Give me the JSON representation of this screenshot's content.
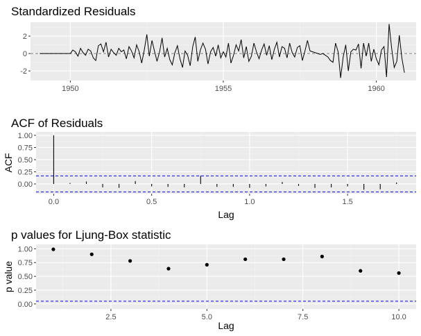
{
  "chart_data": [
    {
      "type": "line",
      "title": "Standardized Residuals",
      "xlabel": "",
      "ylabel": "",
      "xlim": [
        1948.7,
        1961.3
      ],
      "ylim": [
        -3.1,
        3.6
      ],
      "xticks": [
        1950,
        1955,
        1960
      ],
      "xtick_labels": [
        "1950",
        "1955",
        "1960"
      ],
      "yticks": [
        -2,
        0,
        2
      ],
      "ytick_labels": [
        "-2",
        "0",
        "2"
      ],
      "reference_line": 0,
      "grid": true,
      "x": [
        1949.0,
        1949.083,
        1949.167,
        1949.25,
        1949.333,
        1949.417,
        1949.5,
        1949.583,
        1949.667,
        1949.75,
        1949.833,
        1949.917,
        1950.0,
        1950.083,
        1950.167,
        1950.25,
        1950.333,
        1950.417,
        1950.5,
        1950.583,
        1950.667,
        1950.75,
        1950.833,
        1950.917,
        1951.0,
        1951.083,
        1951.167,
        1951.25,
        1951.333,
        1951.417,
        1951.5,
        1951.583,
        1951.667,
        1951.75,
        1951.833,
        1951.917,
        1952.0,
        1952.083,
        1952.167,
        1952.25,
        1952.333,
        1952.417,
        1952.5,
        1952.583,
        1952.667,
        1952.75,
        1952.833,
        1952.917,
        1953.0,
        1953.083,
        1953.167,
        1953.25,
        1953.333,
        1953.417,
        1953.5,
        1953.583,
        1953.667,
        1953.75,
        1953.833,
        1953.917,
        1954.0,
        1954.083,
        1954.167,
        1954.25,
        1954.333,
        1954.417,
        1954.5,
        1954.583,
        1954.667,
        1954.75,
        1954.833,
        1954.917,
        1955.0,
        1955.083,
        1955.167,
        1955.25,
        1955.333,
        1955.417,
        1955.5,
        1955.583,
        1955.667,
        1955.75,
        1955.833,
        1955.917,
        1956.0,
        1956.083,
        1956.167,
        1956.25,
        1956.333,
        1956.417,
        1956.5,
        1956.583,
        1956.667,
        1956.75,
        1956.833,
        1956.917,
        1957.0,
        1957.083,
        1957.167,
        1957.25,
        1957.333,
        1957.417,
        1957.5,
        1957.583,
        1957.667,
        1957.75,
        1957.833,
        1957.917,
        1958.0,
        1958.083,
        1958.167,
        1958.25,
        1958.333,
        1958.417,
        1958.5,
        1958.583,
        1958.667,
        1958.75,
        1958.833,
        1958.917,
        1959.0,
        1959.083,
        1959.167,
        1959.25,
        1959.333,
        1959.417,
        1959.5,
        1959.583,
        1959.667,
        1959.75,
        1959.833,
        1959.917,
        1960.0,
        1960.083,
        1960.167,
        1960.25,
        1960.333,
        1960.417,
        1960.5,
        1960.583,
        1960.667,
        1960.75,
        1960.833,
        1960.917
      ],
      "y": [
        0,
        0,
        0,
        0,
        0,
        0,
        0,
        0,
        0,
        0,
        0,
        0,
        0,
        0.4,
        0.2,
        -0.3,
        0.6,
        0.1,
        -0.2,
        0.5,
        0.3,
        -0.5,
        -0.8,
        0.9,
        1.1,
        0.2,
        1.3,
        -0.4,
        0.5,
        0.1,
        -0.2,
        0.6,
        0.2,
        0.4,
        -0.6,
        0.8,
        0.3,
        -0.5,
        1.0,
        0.2,
        -1.1,
        0.4,
        2.2,
        -0.3,
        1.5,
        0.3,
        -0.9,
        0.2,
        1.8,
        -0.4,
        0.6,
        -0.7,
        -1.3,
        0.1,
        0.9,
        -0.6,
        -1.6,
        0.3,
        -0.2,
        -1.4,
        0.8,
        1.9,
        -0.9,
        0.4,
        1.2,
        0.5,
        -1.2,
        0.2,
        0.7,
        -0.3,
        1.0,
        -0.5,
        0.2,
        -0.4,
        1.2,
        -1.1,
        -0.2,
        1.0,
        0.3,
        1.6,
        -0.5,
        0.8,
        -0.9,
        -0.3,
        1.2,
        0.2,
        -0.6,
        0.4,
        1.1,
        -0.2,
        0.9,
        -0.7,
        0.5,
        1.3,
        -0.4,
        0.8,
        0.6,
        -0.5,
        1.2,
        0.1,
        -0.4,
        0.7,
        0.9,
        -0.8,
        0.3,
        1.5,
        0.3,
        0.2,
        0.1,
        0,
        -0.1,
        0,
        -0.2,
        -0.4,
        -0.8,
        -1.0,
        1.2,
        0.2,
        -2.8,
        -0.4,
        1.0,
        -2.0,
        0.2,
        0.5,
        0.4,
        1.1,
        -1.7,
        1.2,
        -0.3,
        1.2,
        -0.9,
        0.5,
        -0.6,
        -1.3,
        0.4,
        0.8,
        -2.7,
        3.4,
        0.6,
        -1.6,
        -0.9,
        2.1,
        -0.5,
        -2.2,
        0.8,
        -1.8,
        -1.0,
        -0.6
      ],
      "series_color": "#000000",
      "reference_color": "#7f7f7f"
    },
    {
      "type": "bar",
      "title": "ACF of Residuals",
      "xlabel": "Lag",
      "ylabel": "ACF",
      "xlim": [
        -0.09,
        1.85
      ],
      "ylim": [
        -0.2,
        1.07
      ],
      "xticks": [
        0,
        0.5,
        1,
        1.5
      ],
      "xtick_labels": [
        "0.0",
        "0.5",
        "1.0",
        "1.5"
      ],
      "yticks": [
        0,
        0.25,
        0.5,
        0.75,
        1
      ],
      "ytick_labels": [
        "0.00",
        "0.25",
        "0.50",
        "0.75",
        "1.00"
      ],
      "grid": true,
      "lags": [
        0,
        0.0833,
        0.1667,
        0.25,
        0.3333,
        0.4167,
        0.5,
        0.5833,
        0.6667,
        0.75,
        0.8333,
        0.9167,
        1.0,
        1.0833,
        1.1667,
        1.25,
        1.3333,
        1.4167,
        1.5,
        1.5833,
        1.6667,
        1.75
      ],
      "values": [
        1.0,
        0.02,
        0.05,
        -0.07,
        -0.08,
        0.06,
        -0.05,
        -0.06,
        -0.07,
        0.17,
        -0.06,
        -0.06,
        -0.08,
        -0.05,
        0.04,
        -0.04,
        -0.08,
        -0.07,
        -0.05,
        -0.12,
        -0.11,
        0.03
      ],
      "confidence_bounds": [
        0.165,
        -0.165
      ],
      "series_color": "#000000",
      "bound_color": "#0000ff"
    },
    {
      "type": "scatter",
      "title": "p values for Ljung-Box statistic",
      "xlabel": "Lag",
      "ylabel": "p value",
      "xlim": [
        0.55,
        10.45
      ],
      "ylim": [
        -0.09,
        1.08
      ],
      "xticks": [
        2.5,
        5.0,
        7.5,
        10.0
      ],
      "xtick_labels": [
        "2.5",
        "5.0",
        "7.5",
        "10.0"
      ],
      "yticks": [
        0,
        0.25,
        0.5,
        0.75,
        1
      ],
      "ytick_labels": [
        "0.00",
        "0.25",
        "0.50",
        "0.75",
        "1.00"
      ],
      "grid": true,
      "x": [
        1,
        2,
        3,
        4,
        5,
        6,
        7,
        8,
        9,
        10
      ],
      "y": [
        0.99,
        0.9,
        0.78,
        0.64,
        0.71,
        0.81,
        0.81,
        0.86,
        0.6,
        0.56
      ],
      "reference_line": 0.05,
      "series_color": "#000000",
      "reference_color": "#0000ff"
    }
  ]
}
